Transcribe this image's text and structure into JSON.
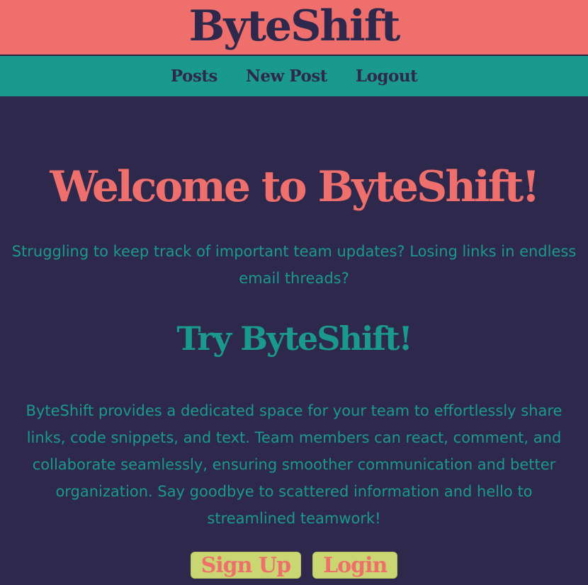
{
  "header": {
    "brand": "ByteShift"
  },
  "nav": {
    "items": [
      {
        "label": "Posts"
      },
      {
        "label": "New Post"
      },
      {
        "label": "Logout"
      }
    ]
  },
  "main": {
    "welcome": "Welcome to ByteShift!",
    "lede": "Struggling to keep track of important team updates? Losing links in endless email threads?",
    "try_heading": "Try ByteShift!",
    "body": "ByteShift provides a dedicated space for your team to effortlessly share links, code snippets, and text. Team members can react, comment, and collaborate seamlessly, ensuring smoother communication and better organization. Say goodbye to scattered information and hello to streamlined teamwork!",
    "buttons": {
      "signup": "Sign Up",
      "login": "Login"
    }
  },
  "colors": {
    "coral": "#ef6f6c",
    "teal": "#1a9a8c",
    "navy": "#2e284c",
    "lime": "#c9d672"
  }
}
